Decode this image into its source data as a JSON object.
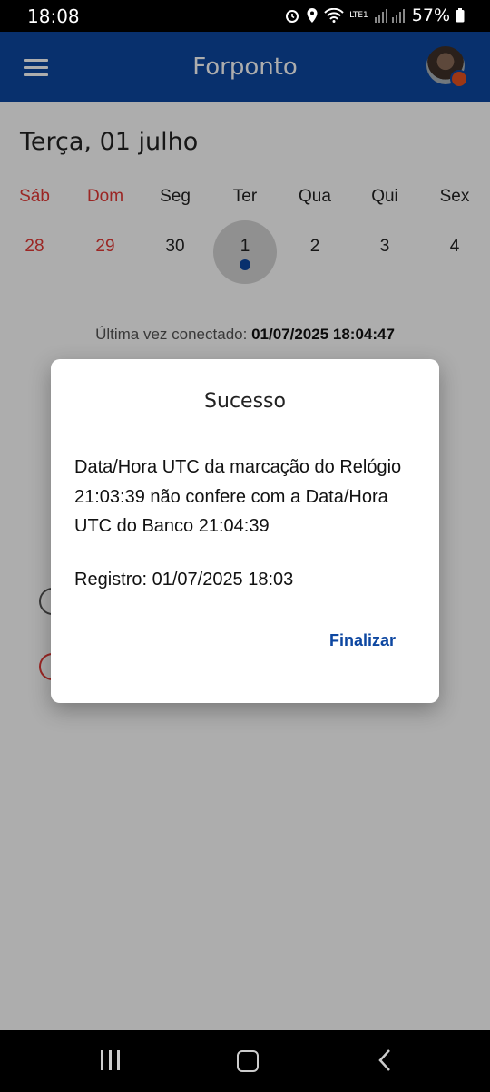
{
  "status": {
    "time": "18:08",
    "battery": "57%",
    "network_label": "LTE1"
  },
  "app": {
    "title": "Forponto",
    "menu_icon": "hamburger-menu-icon",
    "accent": "#0d47a1",
    "badge_color": "#e65120"
  },
  "calendar": {
    "date_heading": "Terça, 01 julho",
    "days": [
      {
        "name": "Sáb",
        "num": "28",
        "weekend": true
      },
      {
        "name": "Dom",
        "num": "29",
        "weekend": true
      },
      {
        "name": "Seg",
        "num": "30",
        "weekend": false
      },
      {
        "name": "Ter",
        "num": "1",
        "weekend": false,
        "selected": true
      },
      {
        "name": "Qua",
        "num": "2",
        "weekend": false
      },
      {
        "name": "Qui",
        "num": "3",
        "weekend": false
      },
      {
        "name": "Sex",
        "num": "4",
        "weekend": false
      }
    ]
  },
  "content": {
    "last_connected_label": "Última vez conectado:",
    "last_connected_value": "01/07/2025 18:04:47"
  },
  "dialog": {
    "title": "Sucesso",
    "message": "Data/Hora UTC da marcação do Relógio 21:03:39 não confere com a Data/Hora UTC do Banco 21:04:39",
    "registro": "Registro: 01/07/2025 18:03",
    "button_label": "Finalizar"
  }
}
